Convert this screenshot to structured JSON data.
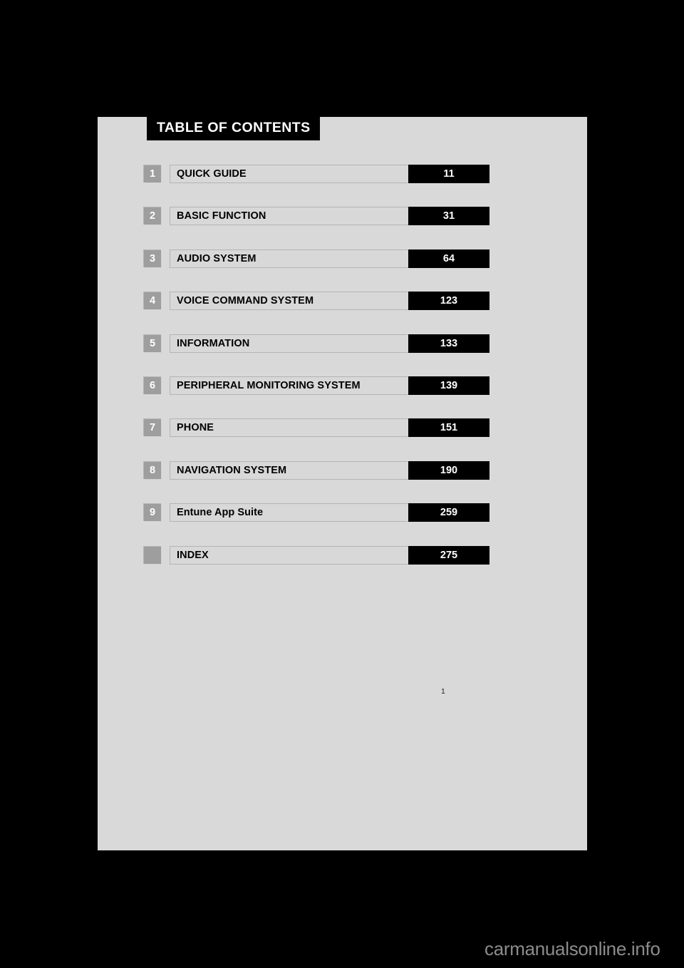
{
  "page": {
    "heading": "TABLE OF CONTENTS",
    "folio": "1",
    "background_color": "#d9d9d9",
    "accent_color": "#000000",
    "badge_color": "#9e9e9e"
  },
  "contents": {
    "rows": [
      {
        "number": "1",
        "title": "QUICK GUIDE",
        "page": "11"
      },
      {
        "number": "2",
        "title": "BASIC FUNCTION",
        "page": "31"
      },
      {
        "number": "3",
        "title": "AUDIO SYSTEM",
        "page": "64"
      },
      {
        "number": "4",
        "title": "VOICE COMMAND SYSTEM",
        "page": "123"
      },
      {
        "number": "5",
        "title": "INFORMATION",
        "page": "133"
      },
      {
        "number": "6",
        "title": "PERIPHERAL MONITORING SYSTEM",
        "page": "139"
      },
      {
        "number": "7",
        "title": "PHONE",
        "page": "151"
      },
      {
        "number": "8",
        "title": "NAVIGATION SYSTEM",
        "page": "190"
      },
      {
        "number": "9",
        "title": "Entune App Suite",
        "page": "259"
      },
      {
        "number": "",
        "title": "INDEX",
        "page": "275"
      }
    ]
  },
  "watermark": {
    "text": "carmanualsonline.info"
  }
}
